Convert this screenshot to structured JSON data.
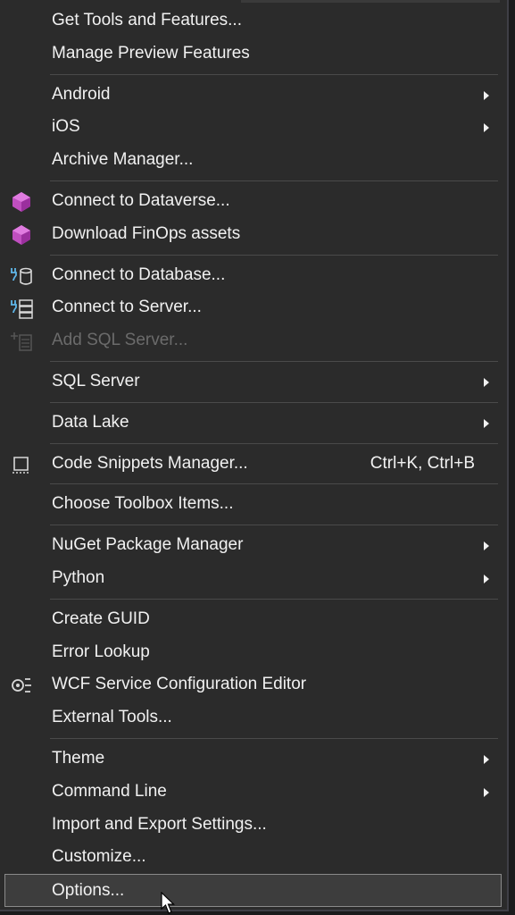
{
  "menu": {
    "get_tools": "Get Tools and Features...",
    "manage_preview": "Manage Preview Features",
    "android": "Android",
    "ios": "iOS",
    "archive_manager": "Archive Manager...",
    "connect_dataverse": "Connect to Dataverse...",
    "download_finops": "Download FinOps assets",
    "connect_database": "Connect to Database...",
    "connect_server": "Connect to Server...",
    "add_sql_server": "Add SQL Server...",
    "sql_server": "SQL Server",
    "data_lake": "Data Lake",
    "code_snippets": "Code Snippets Manager...",
    "code_snippets_shortcut": "Ctrl+K, Ctrl+B",
    "choose_toolbox": "Choose Toolbox Items...",
    "nuget": "NuGet Package Manager",
    "python": "Python",
    "create_guid": "Create GUID",
    "error_lookup": "Error Lookup",
    "wcf_editor": "WCF Service Configuration Editor",
    "external_tools": "External Tools...",
    "theme": "Theme",
    "command_line": "Command Line",
    "import_export": "Import and Export Settings...",
    "customize": "Customize...",
    "options": "Options..."
  },
  "icons": {
    "dataverse": "dataverse-icon",
    "finops": "finops-icon",
    "database": "database-plug-icon",
    "server": "server-plug-icon",
    "add_sql": "add-sql-server-icon",
    "snippets": "code-snippets-icon",
    "wcf": "wcf-config-icon",
    "submenu": "chevron-right-icon",
    "cursor": "mouse-pointer-icon"
  },
  "colors": {
    "menu_bg": "#2b2b2b",
    "text": "#f1f1f1",
    "disabled_text": "#6b6b6b",
    "separator": "#4a4a4a",
    "dataverse_purple": "#c04fc0",
    "plug_blue": "#5fb6e8"
  }
}
